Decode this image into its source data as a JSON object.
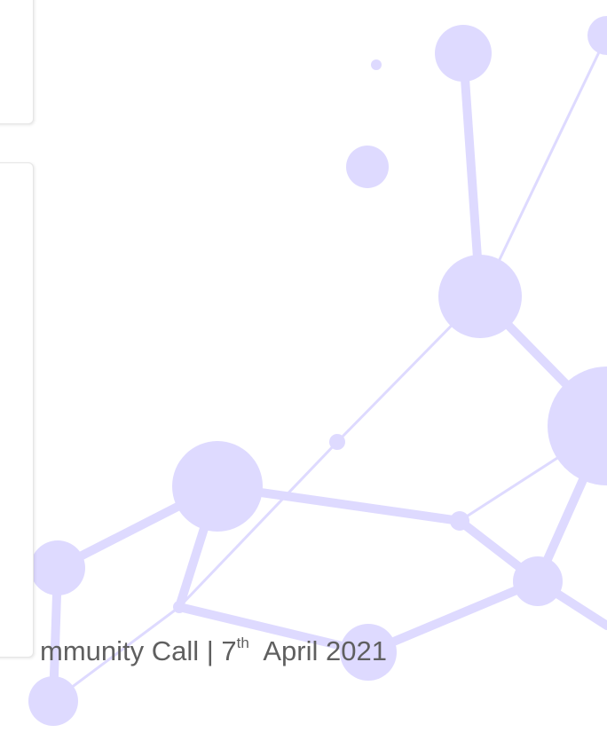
{
  "slide": {
    "caption_prefix": "mmunity Call | 7",
    "caption_superscript": "th",
    "caption_suffix": "April 2021"
  },
  "colors": {
    "node": "#dedaff",
    "line": "#dedaff",
    "text": "#5f5f5f"
  }
}
